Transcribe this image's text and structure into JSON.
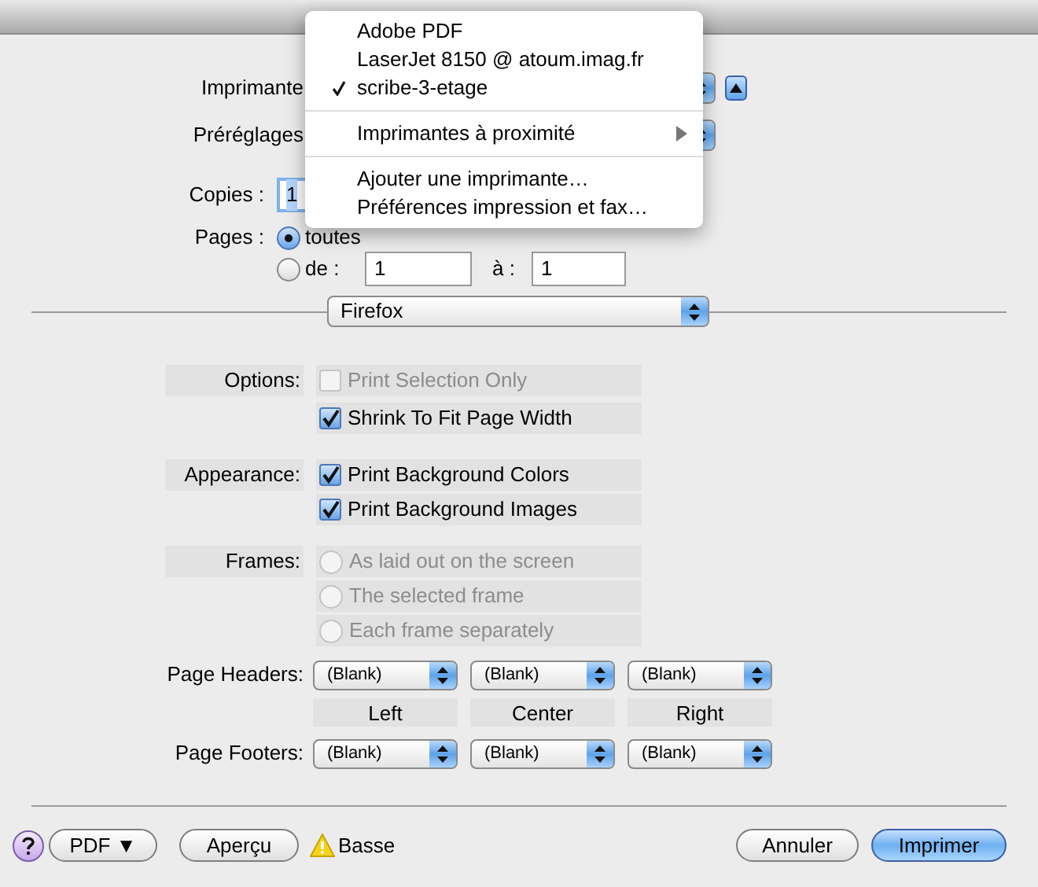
{
  "printer": {
    "label": "Imprimante"
  },
  "presets": {
    "label": "Préréglages"
  },
  "copies": {
    "label": "Copies :",
    "value": "1"
  },
  "pages": {
    "label": "Pages :",
    "options": [
      {
        "label": "toutes",
        "selected": true
      },
      {
        "label": "de :",
        "selected": false
      }
    ],
    "from": "1",
    "to_label": "à :",
    "to": "1"
  },
  "panel_popup": {
    "value": "Firefox"
  },
  "sections": [
    {
      "label": "Options:",
      "items": [
        {
          "kind": "checkbox",
          "label": "Print Selection Only",
          "checked": false,
          "disabled": true
        },
        {
          "kind": "checkbox",
          "label": "Shrink To Fit Page Width",
          "checked": true,
          "disabled": false
        }
      ]
    },
    {
      "label": "Appearance:",
      "items": [
        {
          "kind": "checkbox",
          "label": "Print Background Colors",
          "checked": true,
          "disabled": false
        },
        {
          "kind": "checkbox",
          "label": "Print Background Images",
          "checked": true,
          "disabled": false
        }
      ]
    },
    {
      "label": "Frames:",
      "items": [
        {
          "kind": "radio",
          "label": "As laid out on the screen",
          "selected": false,
          "disabled": true
        },
        {
          "kind": "radio",
          "label": "The selected frame",
          "selected": false,
          "disabled": true
        },
        {
          "kind": "radio",
          "label": "Each frame separately",
          "selected": false,
          "disabled": true
        }
      ]
    }
  ],
  "headers": {
    "label": "Page Headers:",
    "values": [
      "(Blank)",
      "(Blank)",
      "(Blank)"
    ]
  },
  "columns": [
    "Left",
    "Center",
    "Right"
  ],
  "footers": {
    "label": "Page Footers:",
    "values": [
      "(Blank)",
      "(Blank)",
      "(Blank)"
    ]
  },
  "buttons": {
    "pdf": "PDF ▼",
    "preview": "Aperçu",
    "warning": "Basse",
    "cancel": "Annuler",
    "print": "Imprimer"
  },
  "menu": {
    "items": [
      {
        "kind": "item",
        "label": "Adobe PDF",
        "checked": false
      },
      {
        "kind": "item",
        "label": "LaserJet 8150 @ atoum.imag.fr",
        "checked": false
      },
      {
        "kind": "item",
        "label": "scribe-3-etage",
        "checked": true
      },
      {
        "kind": "separator"
      },
      {
        "kind": "submenu",
        "label": "Imprimantes à proximité"
      },
      {
        "kind": "separator"
      },
      {
        "kind": "item",
        "label": "Ajouter une imprimante…",
        "checked": false
      },
      {
        "kind": "item",
        "label": "Préférences impression et fax…",
        "checked": false
      }
    ]
  }
}
